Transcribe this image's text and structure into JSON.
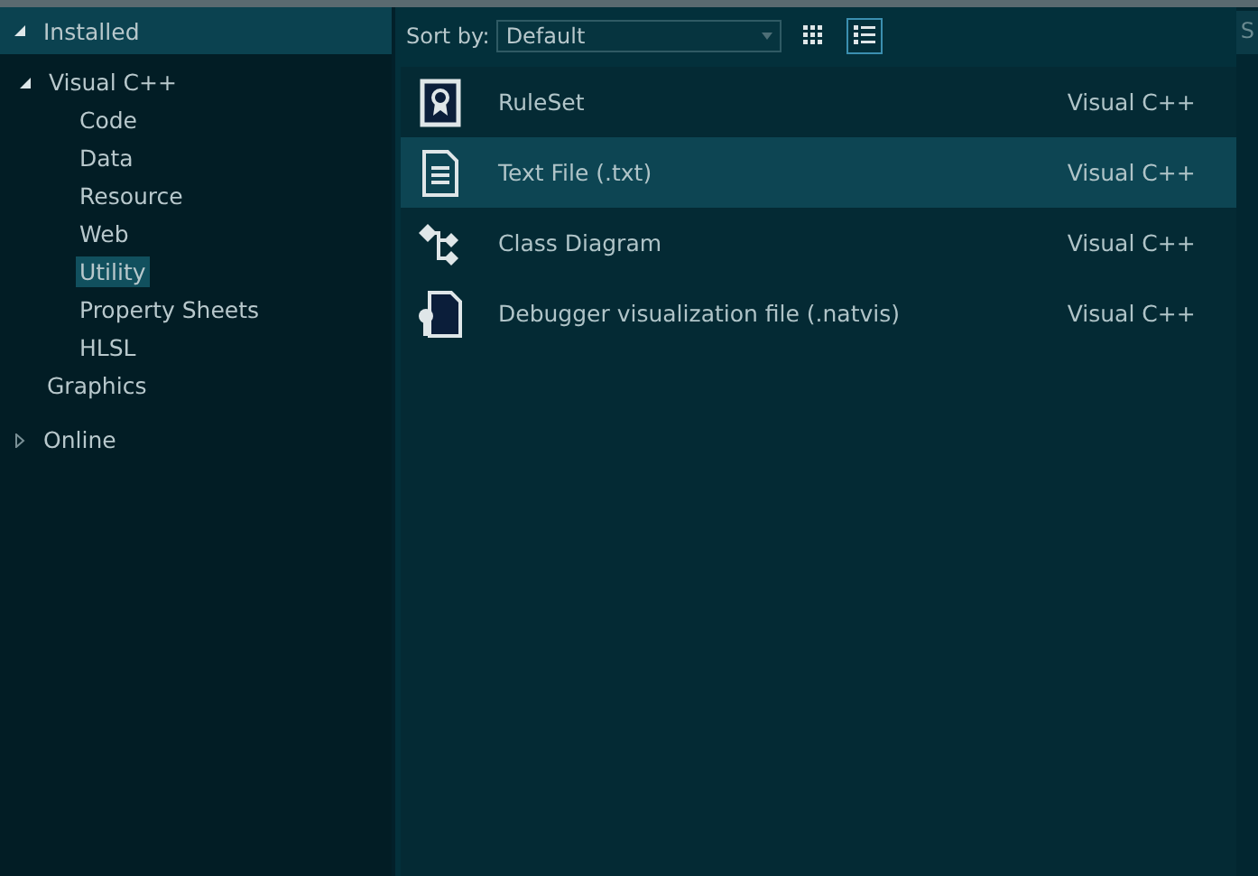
{
  "tree": [
    {
      "label": "Installed",
      "expanded": true,
      "selected": false,
      "children": [
        {
          "label": "Visual C++",
          "expanded": true,
          "selected": false,
          "children": [
            {
              "label": "Code",
              "selected": false
            },
            {
              "label": "Data",
              "selected": false
            },
            {
              "label": "Resource",
              "selected": false
            },
            {
              "label": "Web",
              "selected": false
            },
            {
              "label": "Utility",
              "selected": true
            },
            {
              "label": "Property Sheets",
              "selected": false
            },
            {
              "label": "HLSL",
              "selected": false
            }
          ]
        },
        {
          "label": "Graphics",
          "selected": false
        }
      ]
    },
    {
      "label": "Online",
      "expanded": false,
      "selected": false
    }
  ],
  "toolbar": {
    "sort_label": "Sort by:",
    "sort_value": "Default",
    "view_modes": [
      {
        "kind": "grid",
        "selected": false
      },
      {
        "kind": "list",
        "selected": true
      }
    ]
  },
  "templates": [
    {
      "kind": "ruleset",
      "name": "RuleSet",
      "language": "Visual C++",
      "selected": false
    },
    {
      "kind": "text",
      "name": "Text File (.txt)",
      "language": "Visual C++",
      "selected": true
    },
    {
      "kind": "diagram",
      "name": "Class Diagram",
      "language": "Visual C++",
      "selected": false
    },
    {
      "kind": "debugger",
      "name": "Debugger visualization file (.natvis)",
      "language": "Visual C++",
      "selected": false
    }
  ],
  "right_panel": {
    "search_text": "S"
  }
}
